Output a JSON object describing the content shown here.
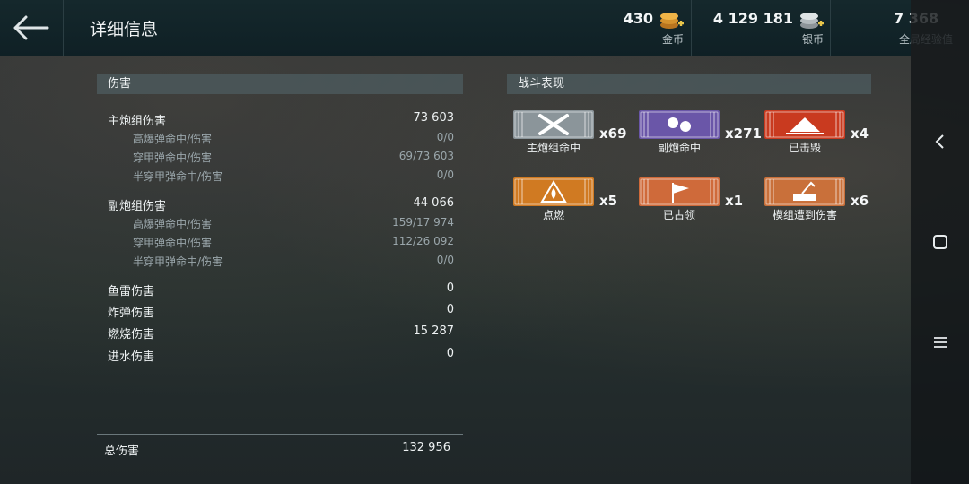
{
  "header": {
    "title": "详细信息",
    "currencies": [
      {
        "amount": "430",
        "label": "金币"
      },
      {
        "amount": "4 129 181",
        "label": "银币"
      },
      {
        "amount": "7 368",
        "label": "全局经验值"
      }
    ]
  },
  "damage": {
    "title": "伤害",
    "rows": [
      {
        "label": "主炮组伤害",
        "value": "73 603"
      },
      {
        "label": "高爆弹命中/伤害",
        "value": "0/0"
      },
      {
        "label": "穿甲弹命中/伤害",
        "value": "69/73 603"
      },
      {
        "label": "半穿甲弹命中/伤害",
        "value": "0/0"
      },
      {
        "label": "副炮组伤害",
        "value": "44 066"
      },
      {
        "label": "高爆弹命中/伤害",
        "value": "159/17 974"
      },
      {
        "label": "穿甲弹命中/伤害",
        "value": "112/26 092"
      },
      {
        "label": "半穿甲弹命中/伤害",
        "value": "0/0"
      },
      {
        "label": "鱼雷伤害",
        "value": "0"
      },
      {
        "label": "炸弹伤害",
        "value": "0"
      },
      {
        "label": "燃烧伤害",
        "value": "15 287"
      },
      {
        "label": "进水伤害",
        "value": "0"
      }
    ],
    "total_label": "总伤害",
    "total_value": "132 956"
  },
  "performance": {
    "title": "战斗表现",
    "medals": [
      {
        "label": "主炮组命中",
        "count": "x69",
        "color": "#8b959a",
        "icon": "crossed-shells-icon"
      },
      {
        "label": "副炮命中",
        "count": "x271",
        "color": "#6a56a8",
        "icon": "shells-icon"
      },
      {
        "label": "已击毁",
        "count": "x4",
        "color": "#c93a1f",
        "icon": "sinking-ship-icon"
      },
      {
        "label": "点燃",
        "count": "x5",
        "color": "#d07a22",
        "icon": "fire-icon"
      },
      {
        "label": "已占领",
        "count": "x1",
        "color": "#cf6a3a",
        "icon": "flag-icon"
      },
      {
        "label": "模组遭到伤害",
        "count": "x6",
        "color": "#c9703a",
        "icon": "damaged-module-icon"
      }
    ]
  }
}
